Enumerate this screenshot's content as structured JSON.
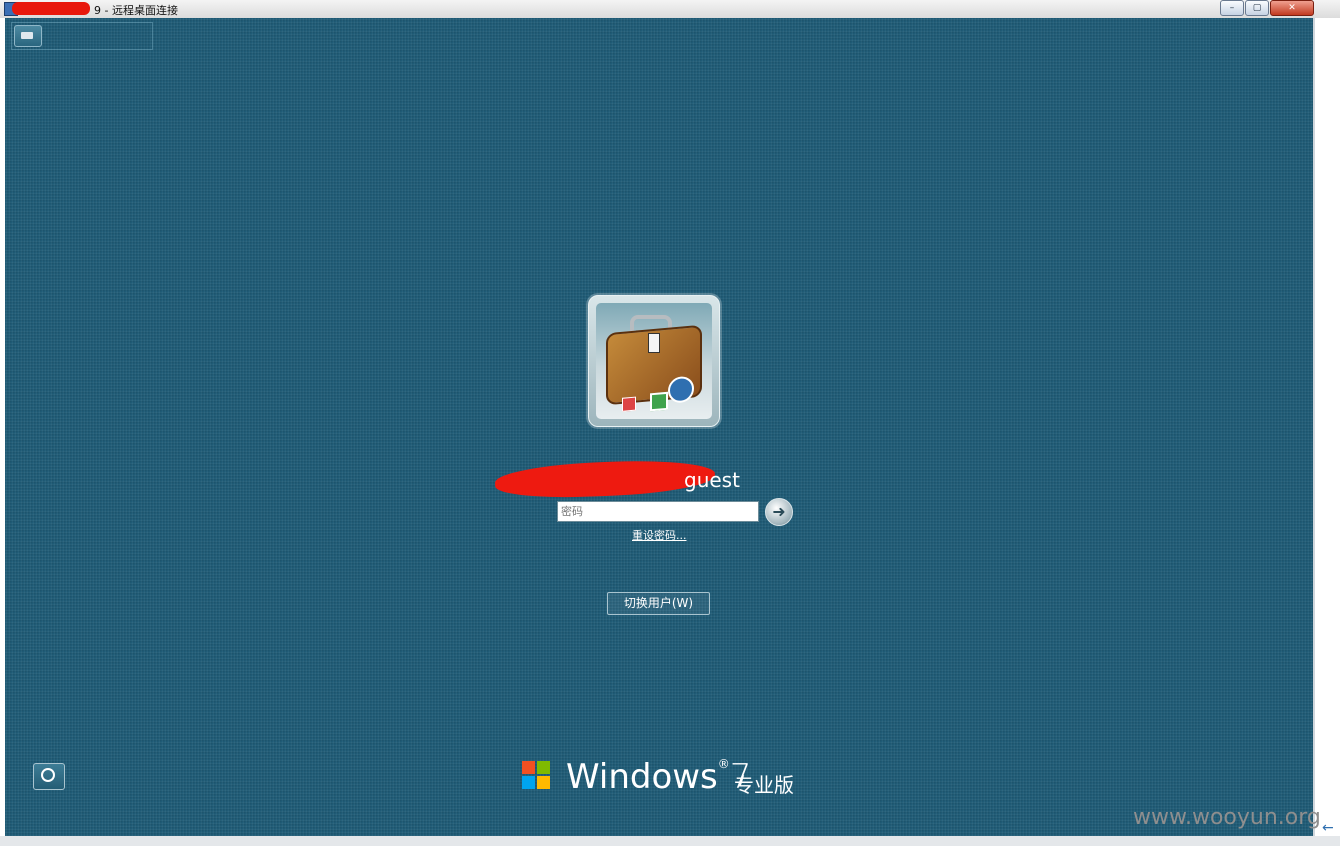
{
  "window": {
    "title": "9 - 远程桌面连接",
    "min_glyph": "–",
    "max_glyph": "▢",
    "close_glyph": "✕"
  },
  "login": {
    "username": "guest",
    "password_placeholder": "密码",
    "submit_glyph": "➜",
    "reset_password_label": "重设密码...",
    "switch_user_label": "切换用户(W)"
  },
  "branding": {
    "product": "Windows",
    "version": "7",
    "edition": "专业版"
  },
  "watermark": "www.wooyun.org",
  "icons": {
    "onscreen_keyboard": "keyboard-icon",
    "ease_of_access": "ease-of-access-icon",
    "windows_logo": "windows-flag-icon",
    "user_avatar": "suitcase-avatar"
  },
  "colors": {
    "background": "#1f5b76",
    "text": "#ffffff",
    "redaction": "#ee1a10"
  }
}
